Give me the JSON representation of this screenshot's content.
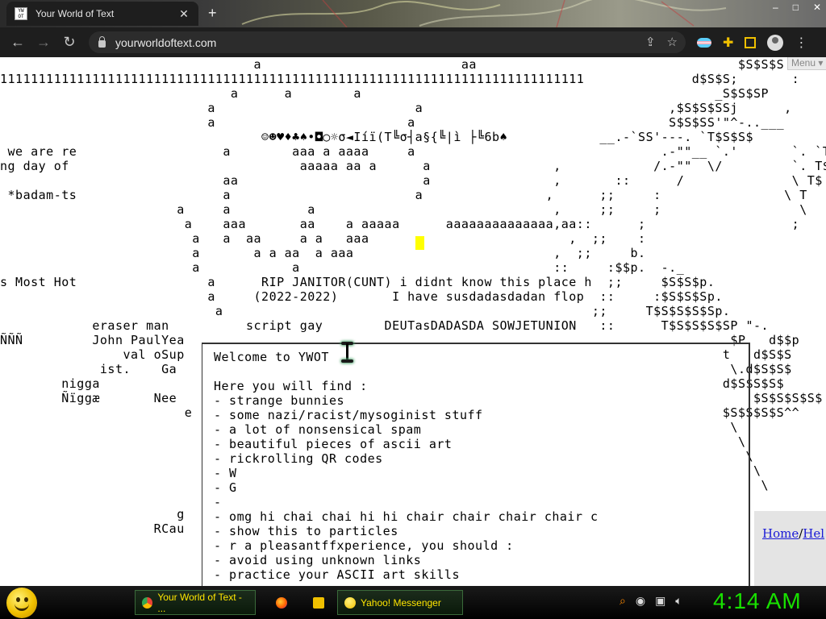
{
  "browser": {
    "tab_title": "Your World of Text",
    "favicon_text": "YW OT",
    "new_tab": "+",
    "url": "yourworldoftext.com",
    "window_controls": [
      "–",
      "□",
      "✕"
    ]
  },
  "page": {
    "menu_label": "Menu ▾",
    "ascii_lines": [
      "                                 a                          aa                                  $S$S$S",
      "1111111111111111111111111111111111111111111111111111111111111111111111111111              d$S$S;       :",
      "                              a      a        a                                              _S$S$SP",
      "                           a                          a                                ,$S$S$SSj      ,",
      "                           a                         a                                 S$S$SS'\"^-..___",
      "                                  ☺☻♥♦♣♠•◘○☼σ◄Iíï(T╚σ┤a§{╚|ì ├╚6b♠            __.-`SS'---. `T$S$S$",
      " we are re                   a        aaa a aaaa     a                                .-\"\"__ `.'       `. `T$S$",
      "ng day of                              aaaaa aa a      a                ,            /.-\"\"  \\/         `. T$S",
      "                             aa                        a                ,       ::      /              \\ T$",
      " *badam-ts                   a                        a                ,      ;;     :                \\ T",
      "                       a     a          a                               ,     ;;     ;                  \\",
      "                        a    aaa       aa    a aaaaa      aaaaaaaaaaaaaa,aa::      ;                   ;",
      "                         a   a  aa     a a   aaa                          ,  ;;    :",
      "                         a       a a aa  a aaa                          ,  ;;     b.",
      "                         a            a                                 ::     :$$p.  -._",
      "s Most Hot                 a      RIP JANITOR(CUNT) i didnt know this place h  ;;     $S$S$p.",
      "                           a     (2022-2022)       I have susdadasdadan flop  ::     :$S$S$Sp.",
      "                            a                                                ;;     T$S$S$S$Sp.",
      "            eraser man          script gay        DEUTasDADASDA SOWJETUNION   ::      T$S$S$S$SP \"-.",
      "ÑÑÑ         John PaulYea                                                                       $P   d$$p",
      "                val oSup                                                                      t   d$S$S",
      "             ist.    Ga                                                                        \\.d$S$S$",
      "        nigga                                                                                 d$S$S$S$",
      "        Ñïggæ       Nee                                                                           $S$S$S$S$",
      "                        e                                                                     $S$S$S$S^^",
      "                                                                                               \\",
      "                                                                                                \\",
      "                                                                                                 \\",
      "                                                                                                  \\",
      "                                                                                                   \\",
      "",
      "                       g",
      "                    RCau"
    ],
    "welcome_lines": [
      "Welcome to YWOT",
      "",
      "Here you will find :",
      "- strange bunnies",
      "- some nazi/racist/mysoginist stuff",
      "- a lot of nonsensical spam",
      "- beautiful pieces of ascii art",
      "- rickrolling QR codes",
      "- W",
      "- G",
      "-",
      "- omg hi chai chai hi hi chair chair chair chair c",
      "- show this to particles",
      "- r a pleasantffxperience, you should :",
      "- avoid using unknown links",
      "- practice your ASCII art skills"
    ],
    "panel": {
      "home": "Home",
      "sep": "/",
      "help": "Hel"
    }
  },
  "taskbar": {
    "tasks": [
      {
        "label": "Your World of Text - ...",
        "icon_color": "#4285f4"
      },
      {
        "label": "",
        "icon_color": "#ff7a00"
      },
      {
        "label": "",
        "icon_color": "#f0c000"
      },
      {
        "label": "Yahoo! Messenger",
        "icon_color": "#f0c000"
      }
    ],
    "clock": "4:14 AM"
  },
  "colors": {
    "accent_yellow": "#ffff00",
    "clock_green": "#18e000",
    "link_blue": "#1a1ad6"
  }
}
